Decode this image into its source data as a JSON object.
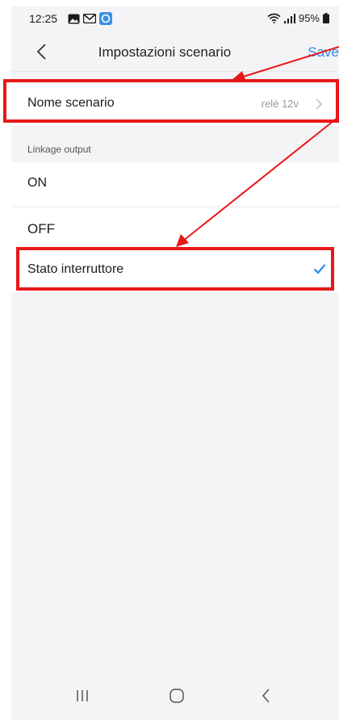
{
  "status_bar": {
    "time": "12:25",
    "battery": "95%"
  },
  "header": {
    "title": "Impostazioni scenario",
    "save_label": "Save"
  },
  "scene_name_row": {
    "label": "Nome scenario",
    "value": "relè 12v"
  },
  "linkage_section": {
    "label": "Linkage output"
  },
  "options": {
    "on_label": "ON",
    "off_label": "OFF",
    "switch_state_label": "Stato interruttore"
  },
  "colors": {
    "accent": "#2f87e4",
    "annotation": "#e81818",
    "background": "#f4f4f6"
  }
}
